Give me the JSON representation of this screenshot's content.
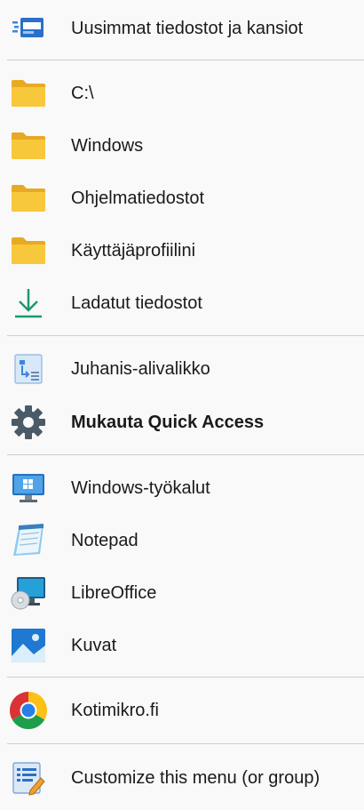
{
  "menu": {
    "items": [
      {
        "label": "Uusimmat tiedostot ja kansiot",
        "icon": "recent-files-icon"
      },
      {
        "label": "C:\\",
        "icon": "folder-icon"
      },
      {
        "label": "Windows",
        "icon": "folder-icon"
      },
      {
        "label": "Ohjelmatiedostot",
        "icon": "folder-icon"
      },
      {
        "label": "Käyttäjäprofiilini",
        "icon": "folder-icon"
      },
      {
        "label": "Ladatut tiedostot",
        "icon": "download-arrow-icon"
      },
      {
        "label": "Juhanis-alivalikko",
        "icon": "submenu-icon"
      },
      {
        "label": "Mukauta Quick Access",
        "icon": "gear-icon"
      },
      {
        "label": "Windows-työkalut",
        "icon": "windows-tools-icon"
      },
      {
        "label": "Notepad",
        "icon": "notepad-icon"
      },
      {
        "label": "LibreOffice",
        "icon": "libreoffice-icon"
      },
      {
        "label": "Kuvat",
        "icon": "photos-icon"
      },
      {
        "label": "Kotimikro.fi",
        "icon": "chrome-icon"
      },
      {
        "label": "Customize this menu (or group)",
        "icon": "customize-menu-icon"
      }
    ]
  },
  "colors": {
    "background": "#f9f9f9",
    "folder": "#f8c83c",
    "accent_green": "#1a9a6c",
    "separator": "#cfcfcf"
  }
}
